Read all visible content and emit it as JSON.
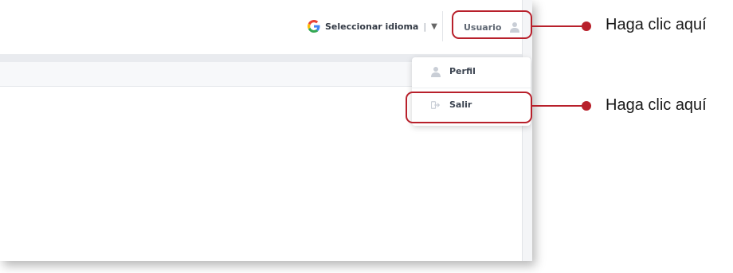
{
  "header": {
    "translate_label": "Seleccionar idioma",
    "translate_separator": "|",
    "translate_caret": "▼",
    "translate_icon": "google-g-icon",
    "user_label": "Usuario",
    "user_icon": "user-icon"
  },
  "dropdown": {
    "items": [
      {
        "label": "Perfil",
        "icon": "user-icon"
      },
      {
        "label": "Salir",
        "icon": "logout-icon"
      }
    ]
  },
  "annotations": {
    "callouts": [
      {
        "text": "Haga clic aquí",
        "target": "user-button"
      },
      {
        "text": "Haga clic aquí",
        "target": "salir-item"
      }
    ],
    "color": "#b8202b"
  },
  "colors": {
    "accent": "#b8202b",
    "text": "#3b4350"
  }
}
